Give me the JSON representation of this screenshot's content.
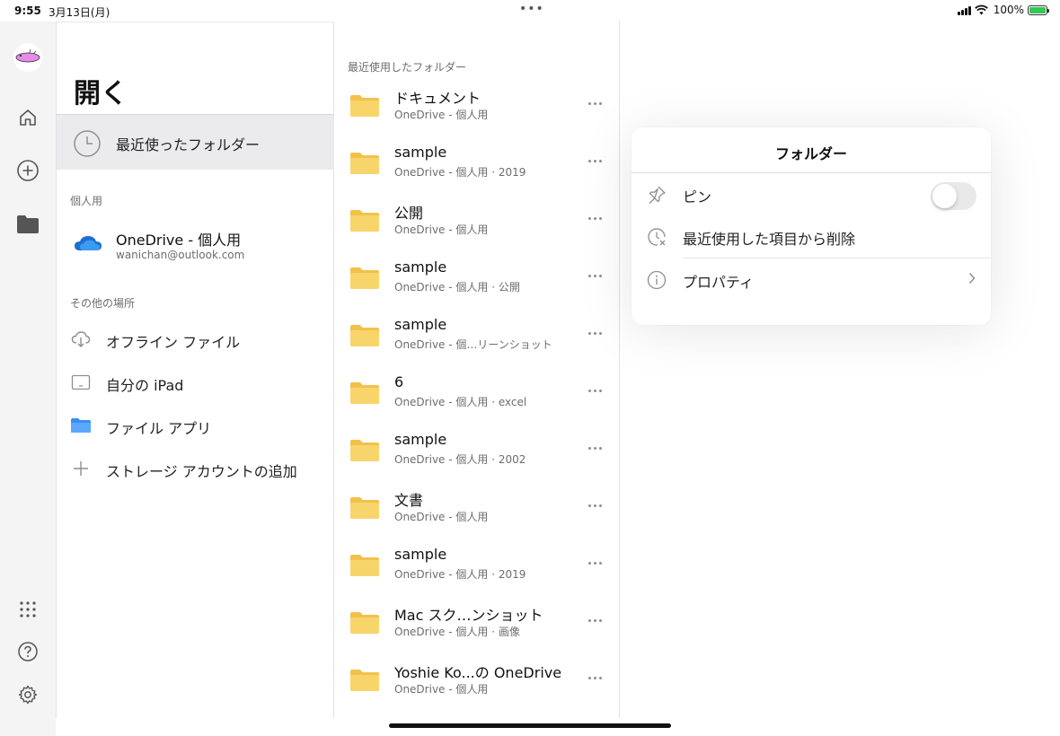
{
  "status_bar": {
    "time": "9:55",
    "date": "3月13日(月)",
    "multitask": "•••",
    "battery_pct": "100%",
    "battery_level": 1.0
  },
  "rail": {
    "icons": [
      "home-icon",
      "plus-circle-icon",
      "folder-icon",
      "apps-grid-icon",
      "help-icon",
      "settings-icon"
    ]
  },
  "nav": {
    "title": "開く",
    "recent_label": "最近使ったフォルダー",
    "personal_section": "個人用",
    "account_name": "OneDrive - 個人用",
    "account_email": "wanichan@outlook.com",
    "other_section": "その他の場所",
    "places": [
      {
        "label": "オフライン ファイル",
        "icon": "cloud-download-icon"
      },
      {
        "label": "自分の iPad",
        "icon": "ipad-icon"
      },
      {
        "label": "ファイル アプリ",
        "icon": "files-app-folder-icon"
      },
      {
        "label": "ストレージ アカウントの追加",
        "icon": "plus-icon"
      }
    ]
  },
  "list": {
    "header": "最近使用したフォルダー",
    "folders": [
      {
        "name": "ドキュメント",
        "sub": "OneDrive - 個人用"
      },
      {
        "name": "sample",
        "sub": "OneDrive - 個人用 · 2019"
      },
      {
        "name": "公開",
        "sub": "OneDrive - 個人用"
      },
      {
        "name": "sample",
        "sub": "OneDrive - 個人用 · 公開"
      },
      {
        "name": "sample",
        "sub": "OneDrive - 個…リーンショット"
      },
      {
        "name": "6",
        "sub": "OneDrive - 個人用 · excel"
      },
      {
        "name": "sample",
        "sub": "OneDrive - 個人用 · 2002"
      },
      {
        "name": "文書",
        "sub": "OneDrive - 個人用"
      },
      {
        "name": "sample",
        "sub": "OneDrive - 個人用 · 2019"
      },
      {
        "name": "Mac スク…ンショット",
        "sub": "OneDrive - 個人用 · 画像"
      },
      {
        "name": "Yoshie Ko...の OneDrive",
        "sub": "OneDrive - 個人用"
      }
    ]
  },
  "popover": {
    "title": "フォルダー",
    "pin_label": "ピン",
    "pin_on": false,
    "remove_label": "最近使用した項目から削除",
    "properties_label": "プロパティ"
  },
  "colors": {
    "accent": "#0a84ff",
    "folder_yellow": "#f8d56b",
    "folder_tab": "#f2c14a",
    "onedrive_blue": "#1f6fd0"
  }
}
